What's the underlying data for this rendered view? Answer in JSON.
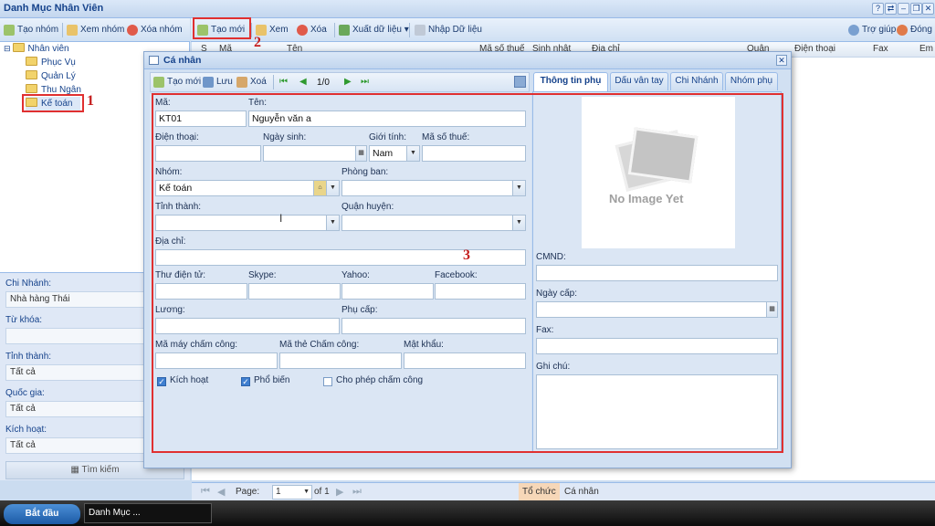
{
  "app": {
    "title": "Danh Mục Nhân Viên",
    "help": "Trợ giúp",
    "close": "Đóng"
  },
  "group_toolbar": {
    "create": "Tạo nhóm",
    "view": "Xem nhóm",
    "delete": "Xóa nhóm"
  },
  "main_toolbar": {
    "create": "Tạo mới",
    "view": "Xem",
    "delete": "Xóa",
    "export": "Xuất dữ liệu",
    "import": "Nhập Dữ liệu"
  },
  "tree": {
    "root": "Nhân viên",
    "children": [
      "Phục Vụ",
      "Quản Lý",
      "Thu Ngân",
      "Kế toán"
    ]
  },
  "filters": {
    "branch_label": "Chi Nhánh:",
    "branch_value": "Nhà hàng Thái",
    "keyword_label": "Từ khóa:",
    "keyword_value": "",
    "city_label": "Tỉnh thành:",
    "city_value": "Tất cả",
    "country_label": "Quốc gia:",
    "country_value": "Tất cả",
    "active_label": "Kích hoạt:",
    "active_value": "Tất cả",
    "search_button": "Tìm kiếm"
  },
  "grid": {
    "columns": [
      "S",
      "Mã",
      "Tên",
      "Mã số thuế",
      "Sinh nhật",
      "Địa chỉ",
      "Quận",
      "Điện thoại",
      "Fax",
      "Em"
    ]
  },
  "pager": {
    "page_label": "Page:",
    "page_value": "1",
    "of_label": "of 1",
    "tab1": "Tổ chức",
    "tab2": "Cá nhân"
  },
  "taskbar": {
    "start": "Bắt đầu",
    "item": "Danh Mục ..."
  },
  "dialog": {
    "title": "Cá nhân",
    "toolbar": {
      "new": "Tạo mới",
      "save": "Lưu",
      "delete": "Xoá",
      "record": "1/0"
    },
    "fields": {
      "code_label": "Mã:",
      "code_value": "KT01",
      "name_label": "Tên:",
      "name_value": "Nguyễn văn a",
      "phone_label": "Điện thoại:",
      "phone_value": "",
      "birth_label": "Ngày sinh:",
      "birth_value": "",
      "gender_label": "Giới tính:",
      "gender_value": "Nam",
      "tax_label": "Mã số thuế:",
      "tax_value": "",
      "group_label": "Nhóm:",
      "group_value": "Kế toán",
      "dept_label": "Phòng ban:",
      "dept_value": "",
      "city_label": "Tỉnh thành:",
      "city_value": "",
      "district_label": "Quận huyện:",
      "district_value": "",
      "address_label": "Địa chỉ:",
      "address_value": "",
      "email_label": "Thư điện tử:",
      "skype_label": "Skype:",
      "yahoo_label": "Yahoo:",
      "facebook_label": "Facebook:",
      "salary_label": "Lương:",
      "allowance_label": "Phụ cấp:",
      "machine_label": "Mã máy chấm công:",
      "card_label": "Mã thẻ Chấm công:",
      "password_label": "Mật khẩu:",
      "active_label": "Kích hoạt",
      "public_label": "Phổ biến",
      "attendance_label": "Cho phép chấm công"
    },
    "checks": {
      "active": true,
      "public": true,
      "attendance": false
    },
    "tabs": [
      "Thông tin phụ",
      "Dấu vân tay",
      "Chi Nhánh",
      "Nhóm phụ"
    ],
    "side": {
      "no_image": "No Image Yet",
      "id_label": "CMND:",
      "issue_label": "Ngày cấp:",
      "fax_label": "Fax:",
      "note_label": "Ghi chú:"
    }
  },
  "annotations": {
    "n1": "1",
    "n2": "2",
    "n3": "3"
  }
}
